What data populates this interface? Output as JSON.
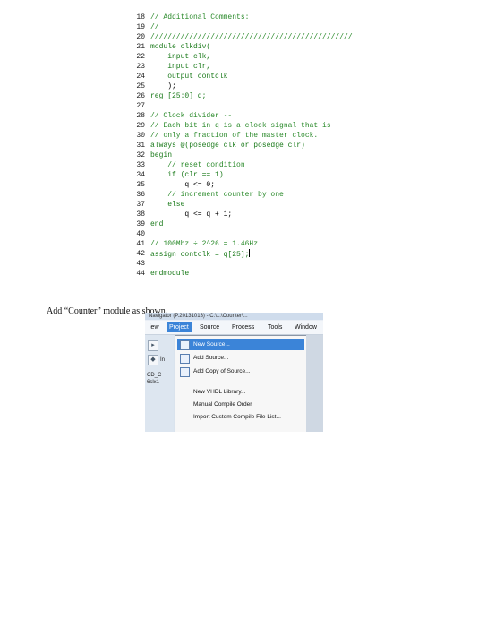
{
  "code": {
    "lines": [
      {
        "num": "18",
        "text": "// Additional Comments:"
      },
      {
        "num": "19",
        "text": "//"
      },
      {
        "num": "20",
        "text": "///////////////////////////////////////////////"
      },
      {
        "num": "21",
        "text": "module clkdiv("
      },
      {
        "num": "22",
        "text": "    input clk,"
      },
      {
        "num": "23",
        "text": "    input clr,"
      },
      {
        "num": "24",
        "text": "    output contclk"
      },
      {
        "num": "25",
        "text": "    );"
      },
      {
        "num": "26",
        "text": "reg [25:0] q;"
      },
      {
        "num": "27",
        "text": ""
      },
      {
        "num": "28",
        "text": "// Clock divider --"
      },
      {
        "num": "29",
        "text": "// Each bit in q is a clock signal that is"
      },
      {
        "num": "30",
        "text": "// only a fraction of the master clock."
      },
      {
        "num": "31",
        "text": "always @(posedge clk or posedge clr)"
      },
      {
        "num": "32",
        "text": "begin"
      },
      {
        "num": "33",
        "text": "    // reset condition"
      },
      {
        "num": "34",
        "text": "    if (clr == 1)"
      },
      {
        "num": "35",
        "text": "        q <= 0;"
      },
      {
        "num": "36",
        "text": "    // increment counter by one"
      },
      {
        "num": "37",
        "text": "    else"
      },
      {
        "num": "38",
        "text": "        q <= q + 1;"
      },
      {
        "num": "39",
        "text": "end"
      },
      {
        "num": "40",
        "text": ""
      },
      {
        "num": "41",
        "text": "// 100Mhz ÷ 2^26 = 1.46Hz"
      },
      {
        "num": "42",
        "text": "assign contclk = q[25];"
      },
      {
        "num": "43",
        "text": ""
      },
      {
        "num": "44",
        "text": "endmodule"
      }
    ]
  },
  "caption": "Add “Counter” module as shown.",
  "screenshot": {
    "titlebar": "Navigator (P.20131013) - C:\\...\\Counter\\...",
    "menus": [
      {
        "label": "iew",
        "active": false
      },
      {
        "label": "Project",
        "active": true
      },
      {
        "label": "Source",
        "active": false
      },
      {
        "label": "Process",
        "active": false
      },
      {
        "label": "Tools",
        "active": false
      },
      {
        "label": "Window",
        "active": false
      }
    ],
    "left_fragments": [
      "In",
      "CD_C",
      "6slx1"
    ],
    "dropdown": [
      {
        "label": "New Source...",
        "icon": "new-source-icon",
        "selected": true
      },
      {
        "label": "Add Source...",
        "icon": "add-source-icon",
        "selected": false
      },
      {
        "label": "Add Copy of Source...",
        "icon": "add-copy-icon",
        "selected": false
      },
      {
        "label": "New VHDL Library...",
        "icon": "",
        "selected": false
      },
      {
        "label": "Manual Compile Order",
        "icon": "",
        "selected": false
      },
      {
        "label": "Import Custom Compile File List...",
        "icon": "",
        "selected": false
      }
    ]
  },
  "colors": {
    "keyword": "#1a7a1a",
    "comment": "#2a8a2a",
    "menu_highlight": "#3b84d8"
  }
}
